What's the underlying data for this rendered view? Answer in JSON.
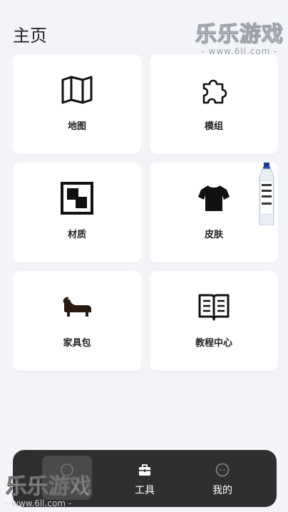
{
  "header": {
    "title": "主页"
  },
  "watermark": {
    "text": "乐乐游戏",
    "url": "- www.6ll.com -"
  },
  "grid": {
    "items": [
      {
        "label": "地图",
        "icon": "map-icon"
      },
      {
        "label": "模组",
        "icon": "puzzle-icon"
      },
      {
        "label": "材质",
        "icon": "texture-icon"
      },
      {
        "label": "皮肤",
        "icon": "tshirt-icon"
      },
      {
        "label": "家具包",
        "icon": "sofa-icon"
      },
      {
        "label": "教程中心",
        "icon": "book-icon"
      }
    ]
  },
  "tabbar": {
    "tabs": [
      {
        "label": "",
        "icon": "home-icon",
        "active": true
      },
      {
        "label": "工具",
        "icon": "toolbox-icon",
        "active": false
      },
      {
        "label": "我的",
        "icon": "profile-icon",
        "active": false
      }
    ]
  },
  "colors": {
    "background": "#f3f4f8",
    "card": "#ffffff",
    "tabbar": "#2f2f2f",
    "text": "#222222"
  }
}
